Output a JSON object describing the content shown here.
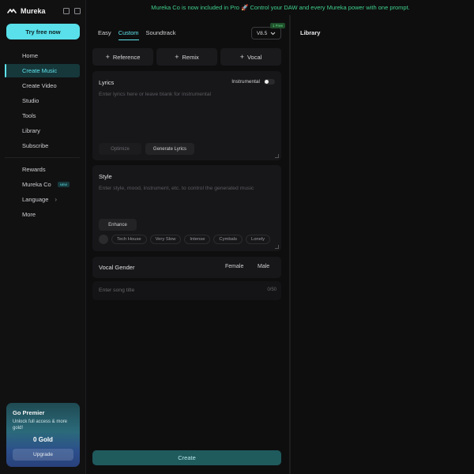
{
  "brand": {
    "name": "Mureka"
  },
  "sidebar": {
    "try_button": "Try free now",
    "items": [
      {
        "label": "Home"
      },
      {
        "label": "Create Music"
      },
      {
        "label": "Create Video"
      },
      {
        "label": "Studio"
      },
      {
        "label": "Tools"
      },
      {
        "label": "Library"
      },
      {
        "label": "Subscribe"
      }
    ],
    "items2": [
      {
        "label": "Rewards"
      },
      {
        "label": "Mureka Co",
        "badge": "NEW"
      },
      {
        "label": "Language",
        "chevron": "›"
      },
      {
        "label": "More"
      }
    ],
    "premier": {
      "title": "Go Premier",
      "subtitle": "Unlock full access & more gold!",
      "gold": "0 Gold",
      "button": "Upgrade"
    }
  },
  "banner": {
    "text": "Mureka Co is now included in Pro 🚀 Control your DAW and every Mureka power with one prompt."
  },
  "main": {
    "tabs": [
      {
        "label": "Easy"
      },
      {
        "label": "Custom"
      },
      {
        "label": "Soundtrack"
      }
    ],
    "version": "V8.5",
    "free_badge": "1 Free",
    "actions": [
      {
        "label": "Reference"
      },
      {
        "label": "Remix"
      },
      {
        "label": "Vocal"
      }
    ],
    "lyrics": {
      "title": "Lyrics",
      "instrumental_label": "Instrumental",
      "placeholder": "Enter lyrics here or leave blank for instrumental",
      "optimize": "Optimize",
      "generate": "Generate Lyrics"
    },
    "style": {
      "title": "Style",
      "placeholder": "Enter style, mood, instrument, etc. to control the generated music",
      "enhance": "Enhance",
      "tags": [
        "Tech House",
        "Very Slow",
        "Intense",
        "Cymbals",
        "Lonely"
      ]
    },
    "vocal": {
      "label": "Vocal Gender",
      "female": "Female",
      "male": "Male"
    },
    "song_title": {
      "placeholder": "Enter song title",
      "count": "0/50"
    },
    "create": "Create"
  },
  "library": {
    "title": "Library"
  },
  "colors": {
    "accent": "#59e0ea",
    "banner": "#3fd08b",
    "bg": "#0e0e0f"
  }
}
